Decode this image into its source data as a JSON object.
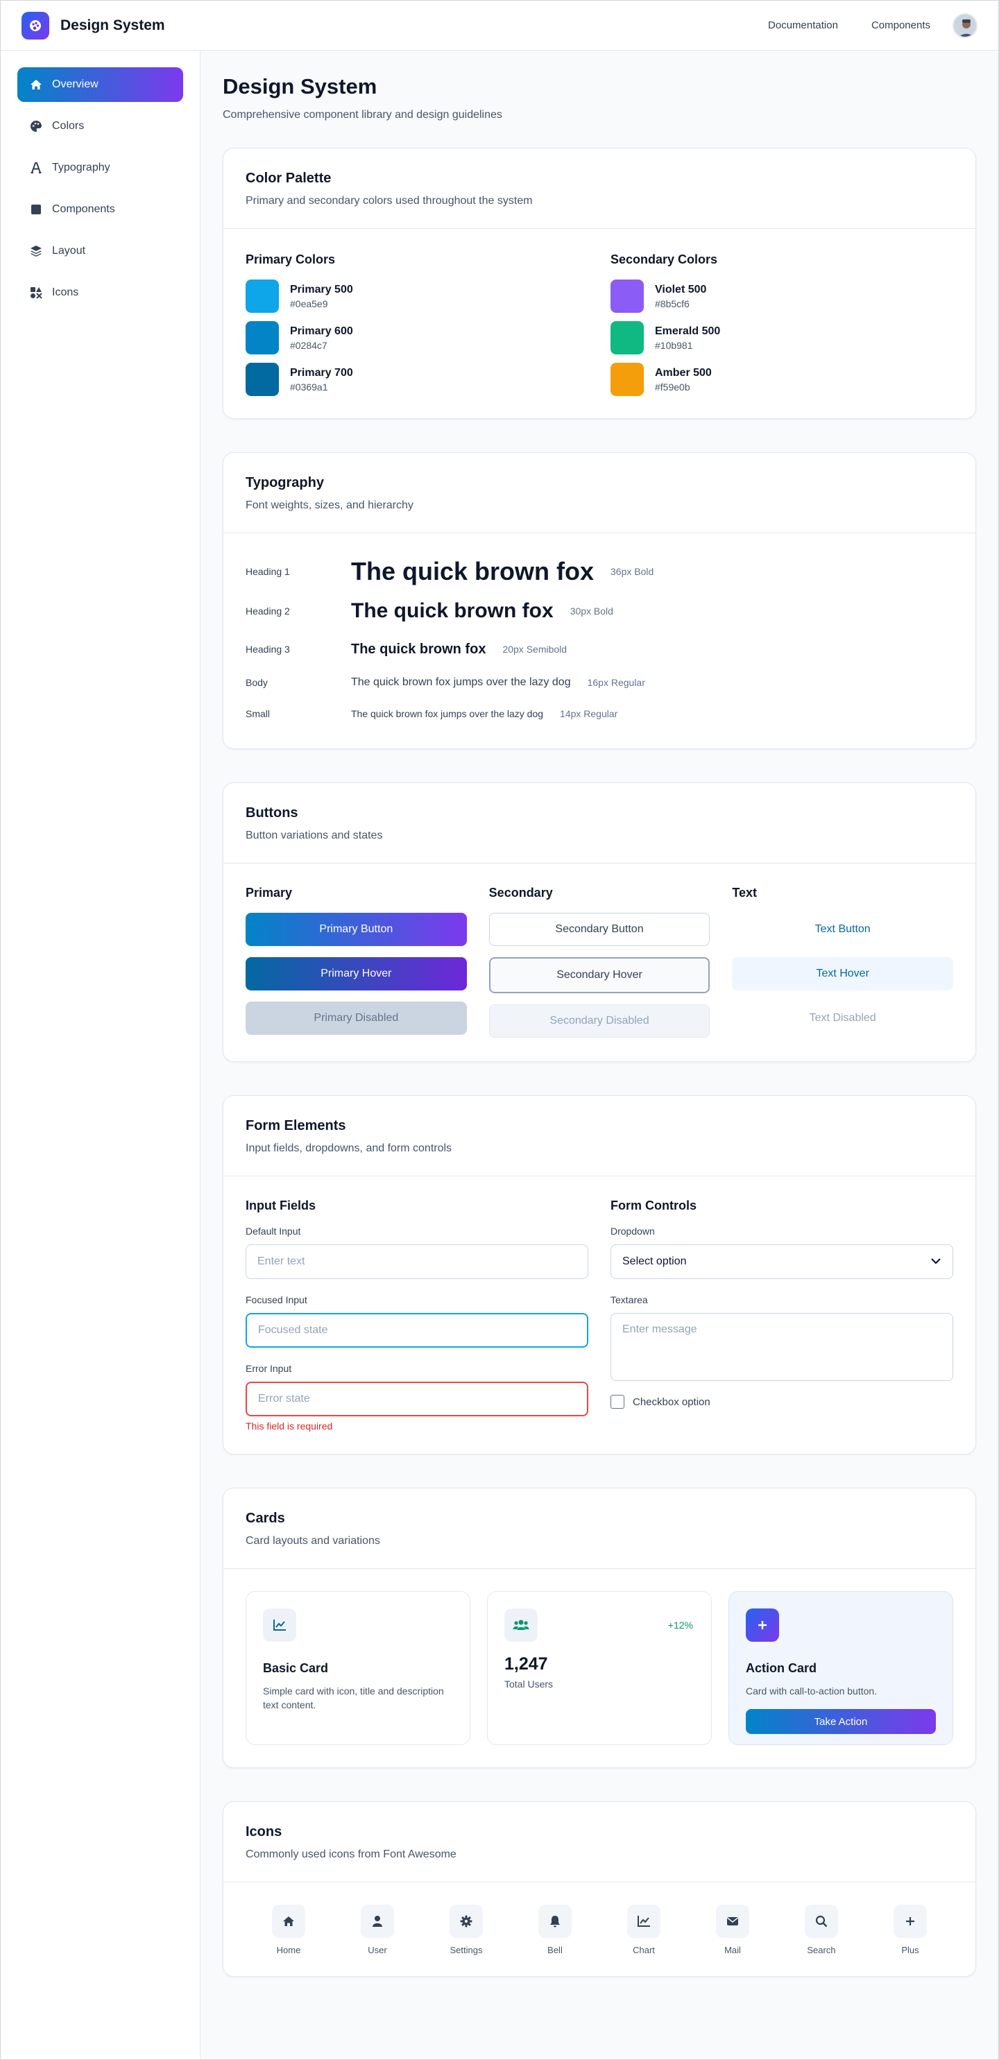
{
  "header": {
    "brand": "Design System",
    "nav": [
      "Documentation",
      "Components"
    ]
  },
  "sidebar": {
    "items": [
      {
        "label": "Overview",
        "icon": "home-icon"
      },
      {
        "label": "Colors",
        "icon": "palette-icon"
      },
      {
        "label": "Typography",
        "icon": "font-icon"
      },
      {
        "label": "Components",
        "icon": "square-icon"
      },
      {
        "label": "Layout",
        "icon": "layers-icon"
      },
      {
        "label": "Icons",
        "icon": "icons-icon"
      }
    ]
  },
  "page": {
    "title": "Design System",
    "subtitle": "Comprehensive component library and design guidelines"
  },
  "colors": {
    "title": "Color Palette",
    "subtitle": "Primary and secondary colors used throughout the system",
    "primary_heading": "Primary Colors",
    "secondary_heading": "Secondary Colors",
    "primary": [
      {
        "name": "Primary 500",
        "hex": "#0ea5e9"
      },
      {
        "name": "Primary 600",
        "hex": "#0284c7"
      },
      {
        "name": "Primary 700",
        "hex": "#0369a1"
      }
    ],
    "secondary": [
      {
        "name": "Violet 500",
        "hex": "#8b5cf6"
      },
      {
        "name": "Emerald 500",
        "hex": "#10b981"
      },
      {
        "name": "Amber 500",
        "hex": "#f59e0b"
      }
    ]
  },
  "typography": {
    "title": "Typography",
    "subtitle": "Font weights, sizes, and hierarchy",
    "rows": [
      {
        "label": "Heading 1",
        "sample": "The quick brown fox",
        "meta": "36px Bold"
      },
      {
        "label": "Heading 2",
        "sample": "The quick brown fox",
        "meta": "30px Bold"
      },
      {
        "label": "Heading 3",
        "sample": "The quick brown fox",
        "meta": "20px Semibold"
      },
      {
        "label": "Body",
        "sample": "The quick brown fox jumps over the lazy dog",
        "meta": "16px Regular"
      },
      {
        "label": "Small",
        "sample": "The quick brown fox jumps over the lazy dog",
        "meta": "14px Regular"
      }
    ]
  },
  "buttons": {
    "title": "Buttons",
    "subtitle": "Button variations and states",
    "primary_heading": "Primary",
    "secondary_heading": "Secondary",
    "text_heading": "Text",
    "primary": [
      "Primary Button",
      "Primary Hover",
      "Primary Disabled"
    ],
    "secondary": [
      "Secondary Button",
      "Secondary Hover",
      "Secondary Disabled"
    ],
    "text": [
      "Text Button",
      "Text Hover",
      "Text Disabled"
    ]
  },
  "forms": {
    "title": "Form Elements",
    "subtitle": "Input fields, dropdowns, and form controls",
    "inputs_heading": "Input Fields",
    "controls_heading": "Form Controls",
    "default_label": "Default Input",
    "default_placeholder": "Enter text",
    "focused_label": "Focused Input",
    "focused_placeholder": "Focused state",
    "error_label": "Error Input",
    "error_placeholder": "Error state",
    "error_message": "This field is required",
    "dropdown_label": "Dropdown",
    "dropdown_value": "Select option",
    "textarea_label": "Textarea",
    "textarea_placeholder": "Enter message",
    "checkbox_label": "Checkbox option"
  },
  "cards": {
    "title": "Cards",
    "subtitle": "Card layouts and variations",
    "basic": {
      "title": "Basic Card",
      "desc": "Simple card with icon, title and description text content."
    },
    "stat": {
      "badge": "+12%",
      "value": "1,247",
      "label": "Total Users"
    },
    "action": {
      "title": "Action Card",
      "desc": "Card with call-to-action button.",
      "button": "Take Action"
    }
  },
  "icons": {
    "title": "Icons",
    "subtitle": "Commonly used icons from Font Awesome",
    "items": [
      "Home",
      "User",
      "Settings",
      "Bell",
      "Chart",
      "Mail",
      "Search",
      "Plus"
    ]
  }
}
